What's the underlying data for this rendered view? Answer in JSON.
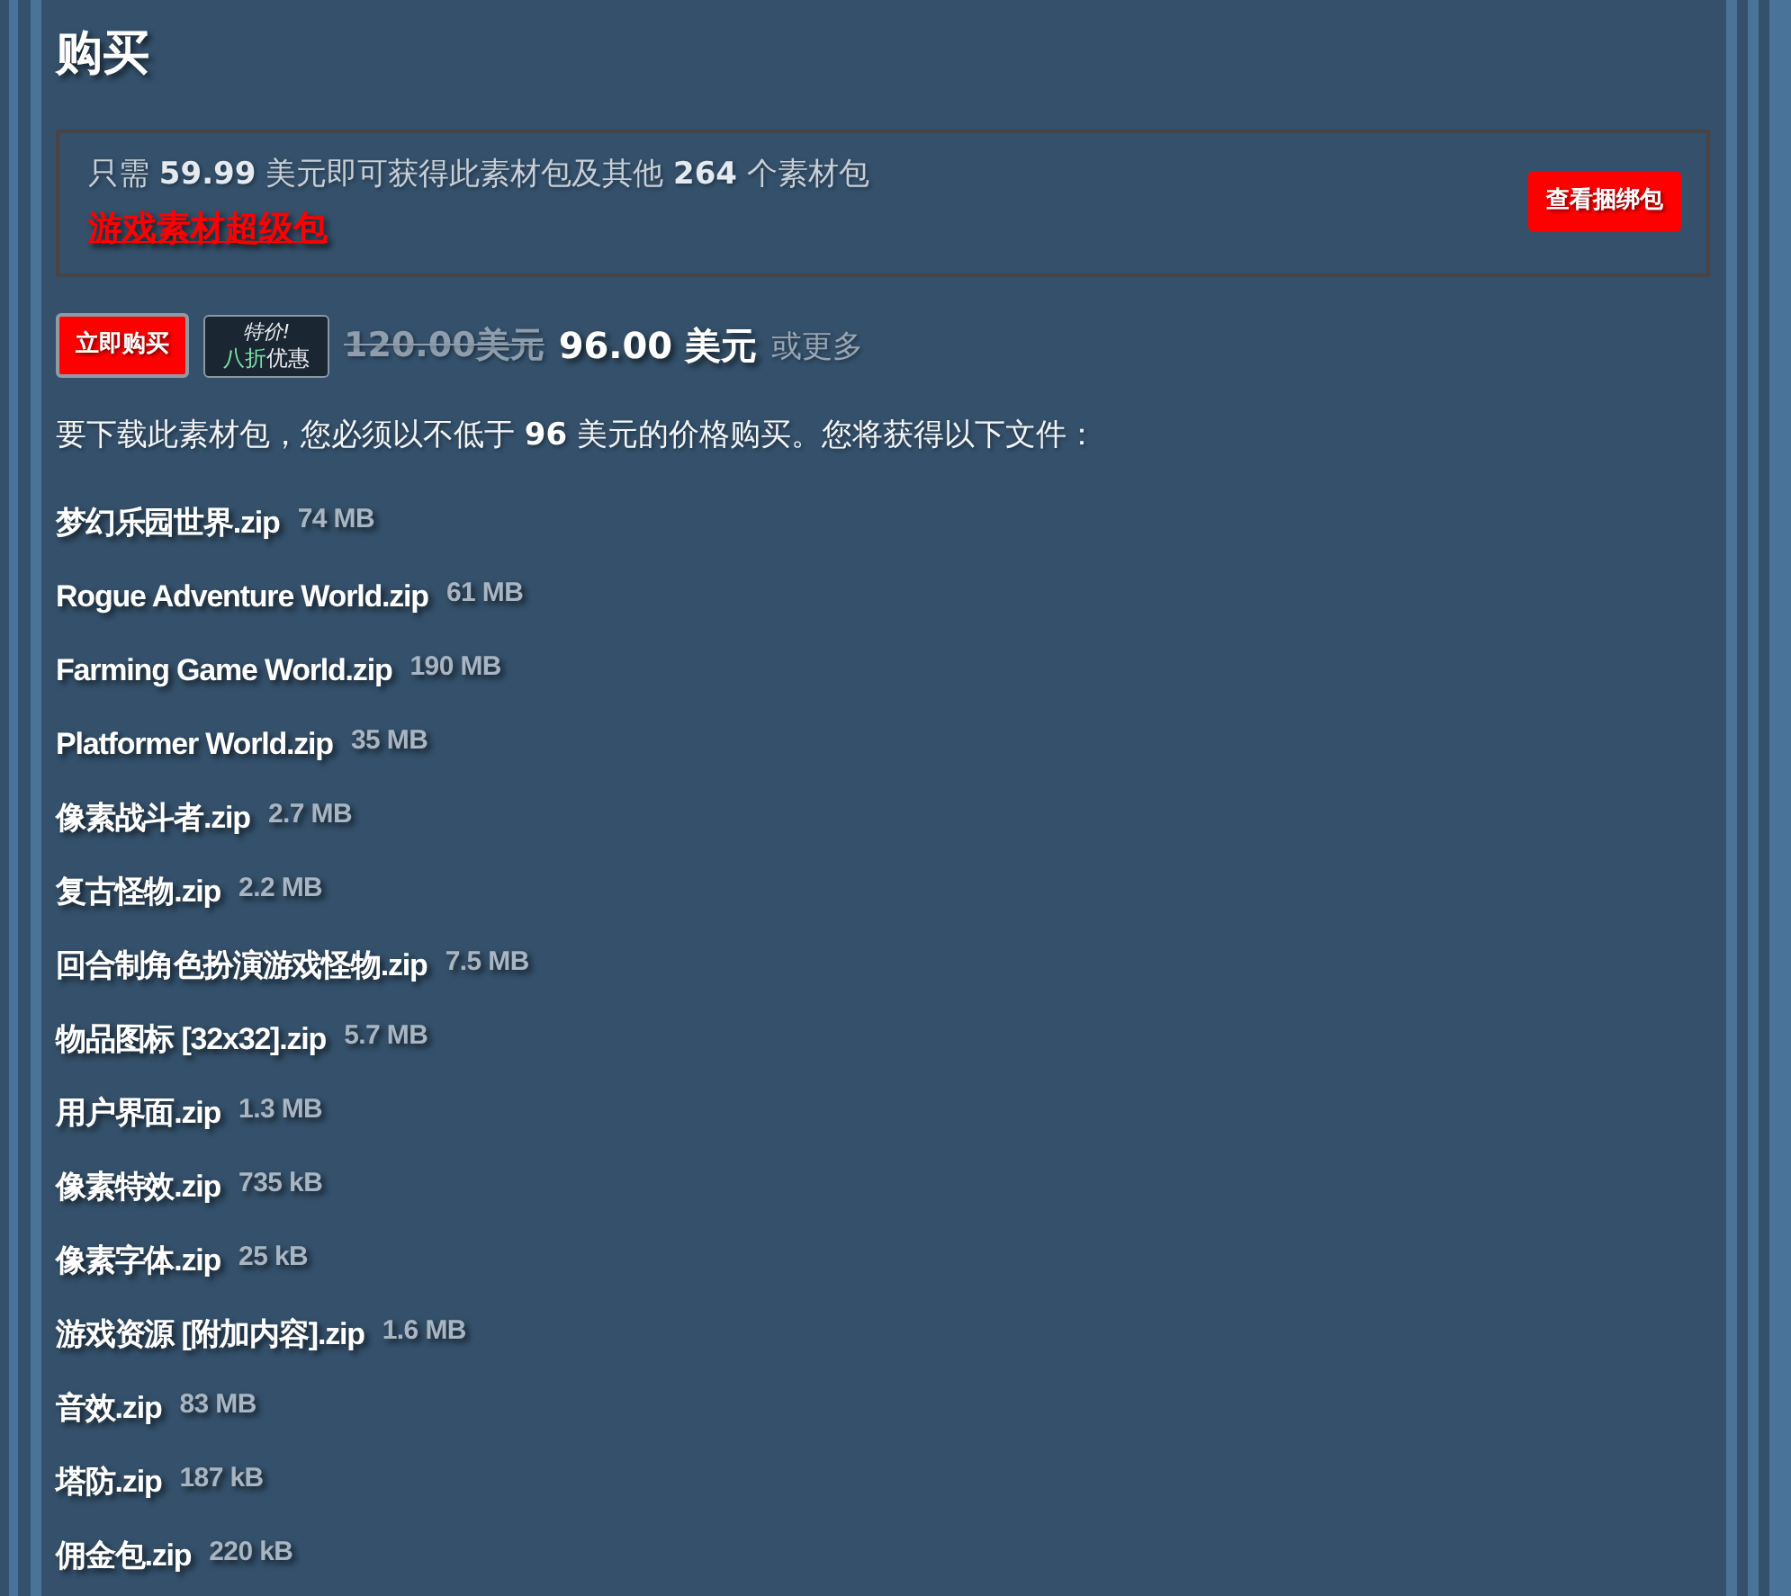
{
  "section_title": "购买",
  "bundle_offer": {
    "text": "只需 **59.99** 美元即可获得此素材包及其他 **264** 个素材包",
    "link": "游戏素材超级包",
    "button": "查看捆绑包"
  },
  "purchase": {
    "buy_button": "立即购买",
    "sale_badge": {
      "label": "特价!",
      "discount": "八折",
      "discount_suffix": "优惠"
    },
    "original_price": "120.00美元",
    "price": "96.00 美元",
    "price_note": "或更多"
  },
  "download_note": "要下载此素材包，您必须以不低于 **96** 美元的价格购买。您将获得以下文件：",
  "files": [
    {
      "name": "梦幻乐园世界.zip",
      "size": "74 MB"
    },
    {
      "name": "Rogue Adventure World.zip",
      "size": "61 MB"
    },
    {
      "name": "Farming Game World.zip",
      "size": "190 MB"
    },
    {
      "name": "Platformer World.zip",
      "size": "35 MB"
    },
    {
      "name": "像素战斗者.zip",
      "size": "2.7 MB"
    },
    {
      "name": "复古怪物.zip",
      "size": "2.2 MB"
    },
    {
      "name": "回合制角色扮演游戏怪物.zip",
      "size": "7.5 MB"
    },
    {
      "name": "物品图标 [32x32].zip",
      "size": "5.7 MB"
    },
    {
      "name": "用户界面.zip",
      "size": "1.3 MB"
    },
    {
      "name": "像素特效.zip",
      "size": "735 kB"
    },
    {
      "name": "像素字体.zip",
      "size": "25 kB"
    },
    {
      "name": "游戏资源 [附加内容].zip",
      "size": "1.6 MB"
    },
    {
      "name": "音效.zip",
      "size": "83 MB"
    },
    {
      "name": "塔防.zip",
      "size": "187 kB"
    },
    {
      "name": "佣金包.zip",
      "size": "220 kB"
    }
  ]
}
